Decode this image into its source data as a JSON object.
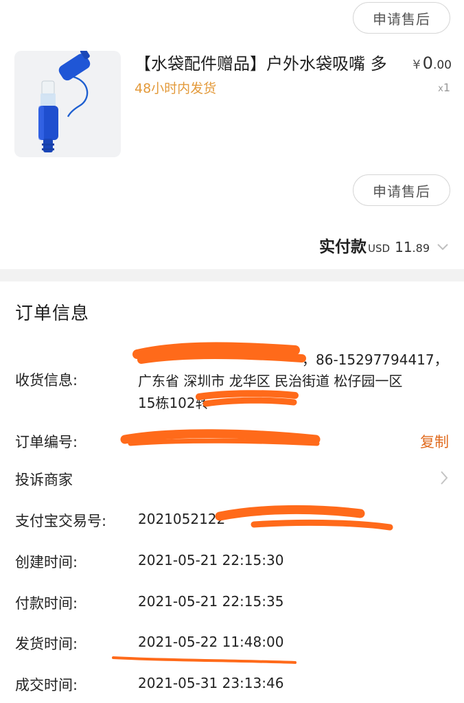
{
  "after_sale_button_top": "申请售后",
  "product": {
    "title": "【水袋配件赠品】户外水袋吸嘴 多",
    "shipping": "48小时内发货",
    "currency": "¥",
    "price_int": "0",
    "price_dec": ".00",
    "qty_prefix": "x",
    "qty": "1"
  },
  "after_sale_button_bottom": "申请售后",
  "total": {
    "label": "实付款",
    "currency": "USD",
    "amount_int": "11",
    "amount_dec": ".89"
  },
  "order_info": {
    "title": "订单信息",
    "receiver": {
      "label": "收货信息:",
      "line1": "，86-15297794417，",
      "line2": "广东省 深圳市 龙华区 民治街道 松仔园一区",
      "line3": "15栋102转"
    },
    "order_no": {
      "label": "订单编号:",
      "copy": "复制"
    },
    "complain": {
      "label": "投诉商家"
    },
    "alipay": {
      "label": "支付宝交易号:",
      "value": "2021052122"
    },
    "created": {
      "label": "创建时间:",
      "value": "2021-05-21 22:15:30"
    },
    "paid": {
      "label": "付款时间:",
      "value": "2021-05-21 22:15:35"
    },
    "shipped": {
      "label": "发货时间:",
      "value": "2021-05-22 11:48:00"
    },
    "closed": {
      "label": "成交时间:",
      "value": "2021-05-31 23:13:46"
    }
  },
  "colors": {
    "redaction": "#ff6a1a",
    "accent": "#e06b1f",
    "shipping_text": "#e39a3b"
  }
}
